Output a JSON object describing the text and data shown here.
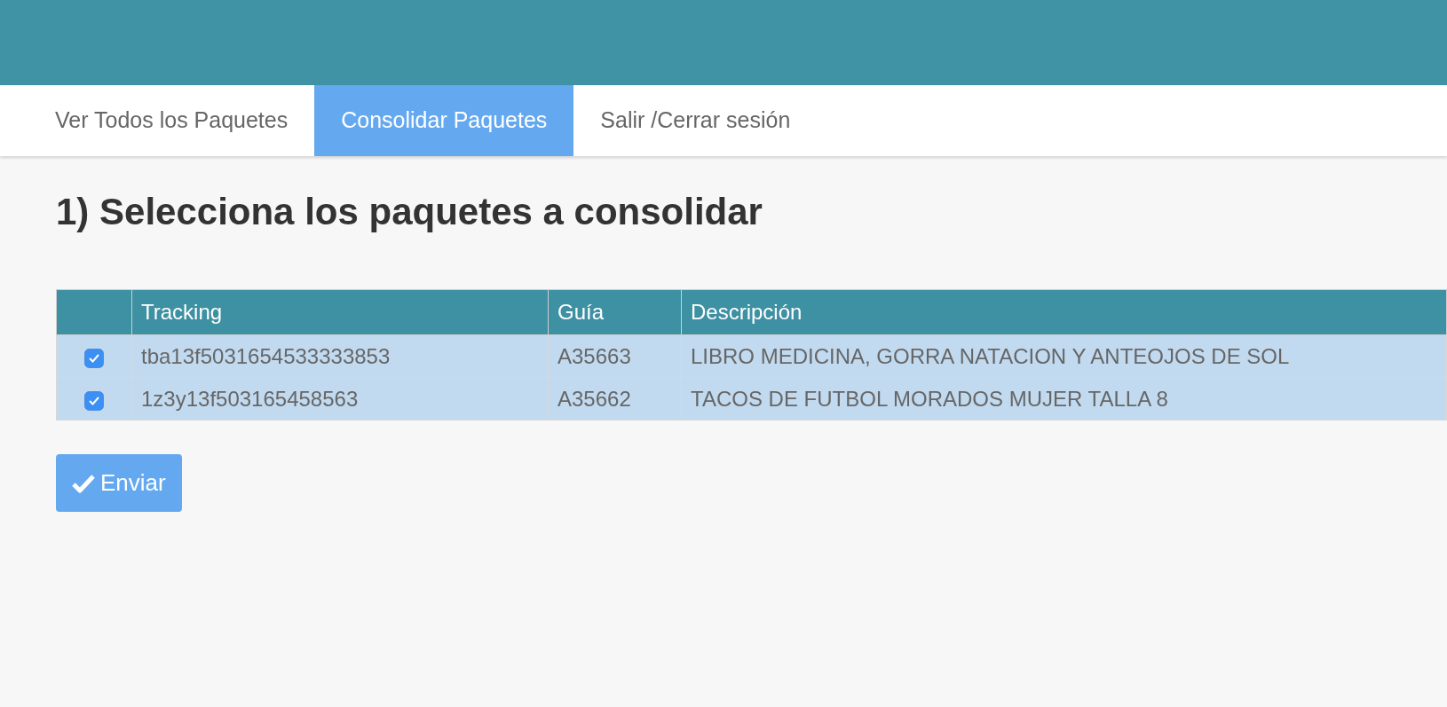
{
  "nav": {
    "tabs": [
      {
        "label": "Ver Todos los Paquetes",
        "selected": false
      },
      {
        "label": "Consolidar Paquetes",
        "selected": true
      },
      {
        "label": "Salir /Cerrar sesión",
        "selected": false
      }
    ]
  },
  "heading": "1) Selecciona los paquetes a consolidar",
  "table": {
    "columns": [
      "Tracking",
      "Guía",
      "Descripción"
    ],
    "rows": [
      {
        "checked": true,
        "tracking": "tba13f5031654533333853",
        "guia": "A35663",
        "descripcion": "LIBRO MEDICINA, GORRA NATACION Y ANTEOJOS DE SOL"
      },
      {
        "checked": true,
        "tracking": "1z3y13f503165458563",
        "guia": "A35662",
        "descripcion": "TACOS DE FUTBOL MORADOS MUJER TALLA 8"
      }
    ]
  },
  "submit_button": {
    "label": "Enviar"
  }
}
